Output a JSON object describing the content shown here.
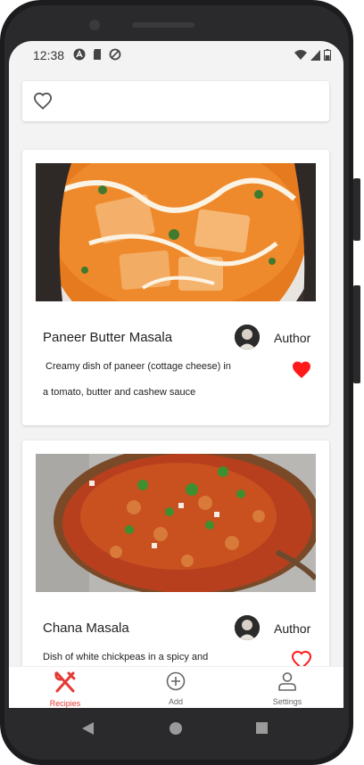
{
  "status_bar": {
    "time": "12:38"
  },
  "recipes": [
    {
      "title": "Paneer Butter Masala",
      "author": "Author",
      "description_line1": "Creamy dish of paneer (cottage cheese) in",
      "description_line2": "a tomato, butter and cashew sauce",
      "favorited": true
    },
    {
      "title": "Chana Masala",
      "author": "Author",
      "description_line1": "Dish of white chickpeas in a spicy and",
      "favorited": false
    }
  ],
  "bottom_nav": {
    "recipes_label": "Recipies",
    "add_label": "Add",
    "settings_label": "Settings"
  },
  "colors": {
    "accent": "#e53935",
    "heart": "#ff1a1a"
  }
}
